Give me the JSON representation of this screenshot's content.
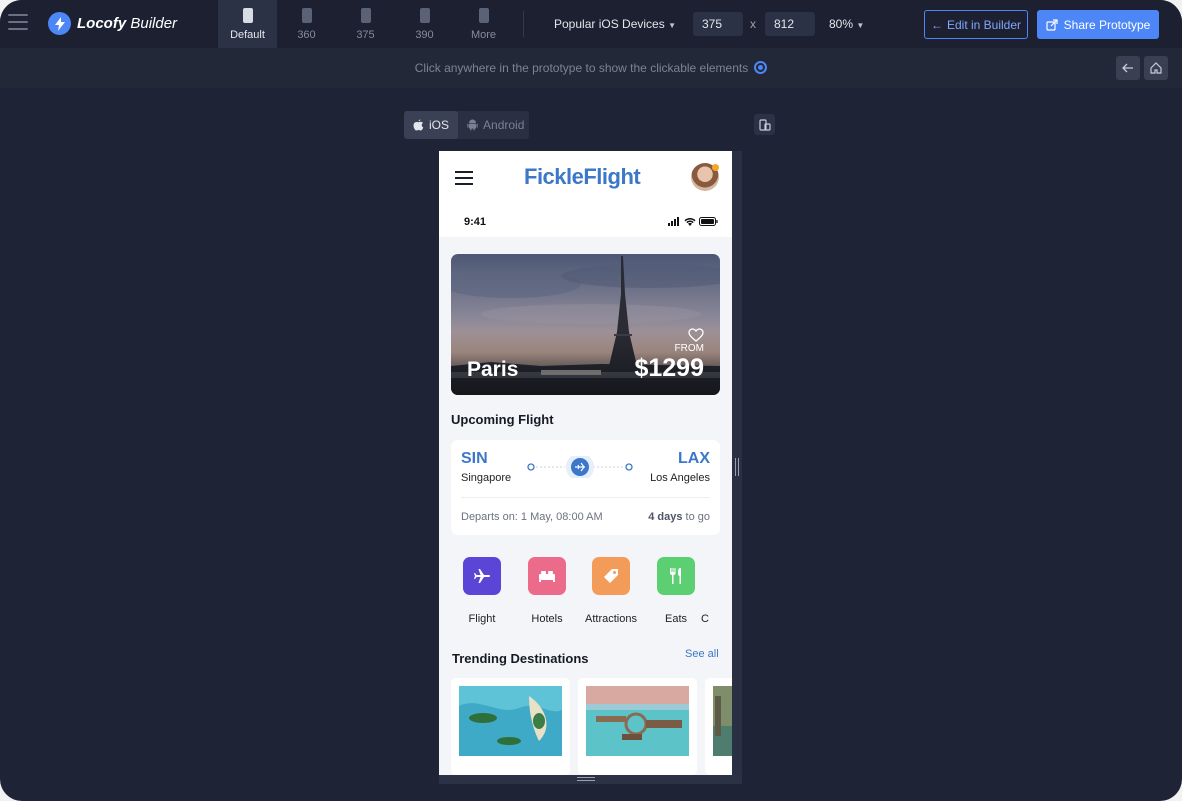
{
  "topbar": {
    "brand_name": "Locofy",
    "brand_suffix": "Builder",
    "device_tabs": [
      {
        "label": "Default",
        "active": true
      },
      {
        "label": "360",
        "active": false
      },
      {
        "label": "375",
        "active": false
      },
      {
        "label": "390",
        "active": false
      },
      {
        "label": "More",
        "active": false
      }
    ],
    "device_preset": "Popular iOS Devices",
    "width_value": "375",
    "dim_separator": "x",
    "height_value": "812",
    "zoom": "80%",
    "edit_button": "Edit in Builder",
    "share_button": "Share Prototype",
    "accent_color": "#4c86f7"
  },
  "infobar": {
    "hint": "Click anywhere in the prototype to show the clickable elements"
  },
  "os_toggle": {
    "ios_label": "iOS",
    "android_label": "Android",
    "selected": "iOS"
  },
  "app": {
    "brand": "FickleFlight",
    "status_time": "9:41",
    "hero": {
      "city": "Paris",
      "from_label": "FROM",
      "price": "$1299"
    },
    "upcoming_title": "Upcoming Flight",
    "flight": {
      "from_code": "SIN",
      "from_city": "Singapore",
      "to_code": "LAX",
      "to_city": "Los Angeles",
      "departs": "Departs on: 1 May, 08:00 AM",
      "days_bold": "4 days",
      "days_rest": "to go"
    },
    "categories": [
      {
        "label": "Flight",
        "color": "#5a45d6",
        "icon": "airplane-icon"
      },
      {
        "label": "Hotels",
        "color": "#ec6a8a",
        "icon": "bed-icon"
      },
      {
        "label": "Attractions",
        "color": "#f39c5a",
        "icon": "tag-icon"
      },
      {
        "label": "Eats",
        "color": "#5ccf72",
        "icon": "cutlery-icon"
      }
    ],
    "trending_title": "Trending Destinations",
    "see_all": "See all",
    "brand_color": "#3d77c9"
  }
}
